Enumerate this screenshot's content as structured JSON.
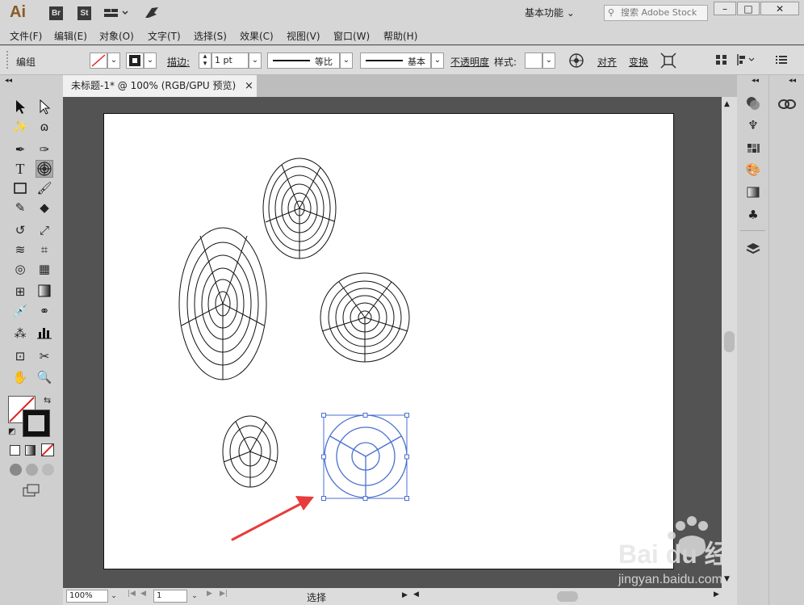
{
  "app": {
    "logo": "Ai",
    "br": "Br",
    "st": "St",
    "workspace": "基本功能",
    "search_placeholder": "搜索 Adobe Stock"
  },
  "menu": [
    "文件(F)",
    "编辑(E)",
    "对象(O)",
    "文字(T)",
    "选择(S)",
    "效果(C)",
    "视图(V)",
    "窗口(W)",
    "帮助(H)"
  ],
  "control": {
    "selection_label": "编组",
    "stroke_label": "描边:",
    "stroke_weight": "1 pt",
    "profile_label": "等比",
    "brush_label": "基本",
    "opacity_label": "不透明度",
    "style_label": "样式:",
    "align_label": "对齐",
    "transform_label": "变换"
  },
  "document": {
    "tab_title": "未标题-1* @ 100% (RGB/GPU 预览)",
    "close_icon": "×"
  },
  "status": {
    "zoom": "100%",
    "artboard_number": "1",
    "tool_name": "选择"
  },
  "watermark": {
    "domain": "jingyan.baidu.com",
    "brand": "Bai du 经验"
  },
  "colors": {
    "selection": "#4a6fd0",
    "arrow": "#e83c3c"
  }
}
